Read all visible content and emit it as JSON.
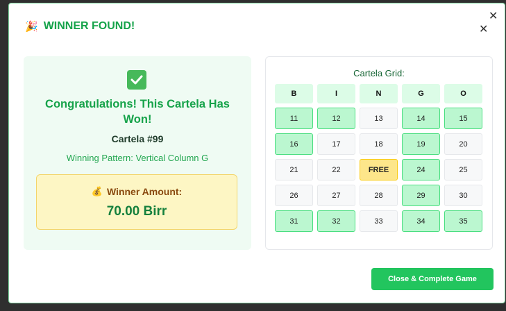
{
  "modal": {
    "title": "WINNER FOUND!",
    "title_icon": "party-popper-icon",
    "close_symbol": "✕"
  },
  "result": {
    "check_icon": "check-mark-icon",
    "congrats": "Congratulations! This Cartela Has Won!",
    "cartela": "Cartela #99",
    "pattern": "Winning Pattern: Vertical Column G",
    "amount_icon": "money-bag-icon",
    "amount_label": "Winner Amount:",
    "amount_value": "70.00 Birr"
  },
  "grid": {
    "title": "Cartela Grid:",
    "headers": [
      "B",
      "I",
      "N",
      "G",
      "O"
    ],
    "rows": [
      [
        {
          "v": "11",
          "m": true
        },
        {
          "v": "12",
          "m": true
        },
        {
          "v": "13",
          "m": false
        },
        {
          "v": "14",
          "m": true
        },
        {
          "v": "15",
          "m": true
        }
      ],
      [
        {
          "v": "16",
          "m": true
        },
        {
          "v": "17",
          "m": false
        },
        {
          "v": "18",
          "m": false
        },
        {
          "v": "19",
          "m": true
        },
        {
          "v": "20",
          "m": false
        }
      ],
      [
        {
          "v": "21",
          "m": false
        },
        {
          "v": "22",
          "m": false
        },
        {
          "v": "FREE",
          "m": false,
          "free": true
        },
        {
          "v": "24",
          "m": true
        },
        {
          "v": "25",
          "m": false
        }
      ],
      [
        {
          "v": "26",
          "m": false
        },
        {
          "v": "27",
          "m": false
        },
        {
          "v": "28",
          "m": false
        },
        {
          "v": "29",
          "m": true
        },
        {
          "v": "30",
          "m": false
        }
      ],
      [
        {
          "v": "31",
          "m": true
        },
        {
          "v": "32",
          "m": true
        },
        {
          "v": "33",
          "m": false
        },
        {
          "v": "34",
          "m": true
        },
        {
          "v": "35",
          "m": true
        }
      ]
    ]
  },
  "actions": {
    "close_complete": "Close & Complete Game"
  },
  "colors": {
    "accent": "#22c55e",
    "marked": "#bbf7d0",
    "free": "#fde68a"
  }
}
